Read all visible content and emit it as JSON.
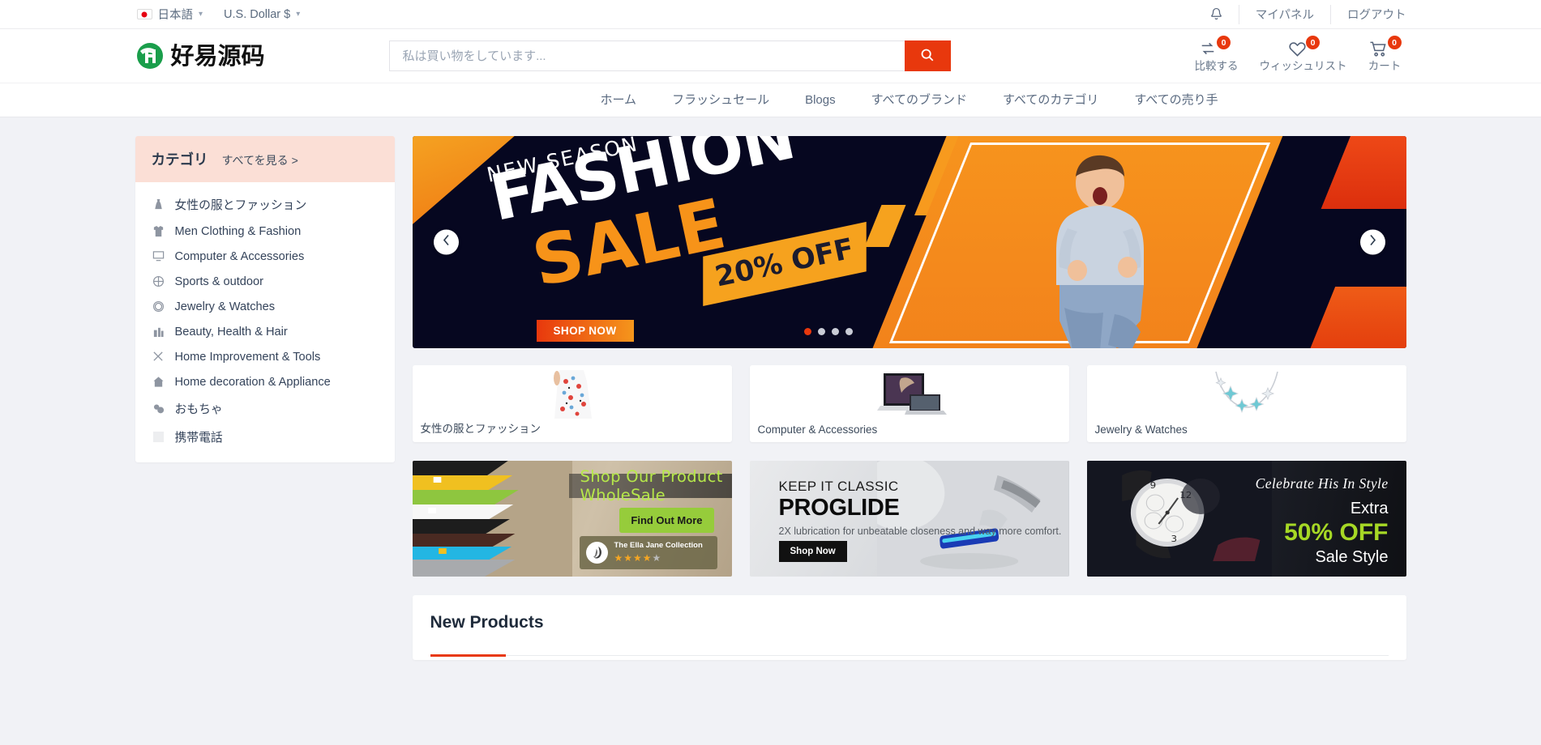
{
  "topbar": {
    "language": "日本語",
    "currency": "U.S. Dollar $",
    "bell_icon": "bell-icon",
    "my_panel": "マイパネル",
    "logout": "ログアウト"
  },
  "header": {
    "logo_text": "好易源码",
    "logo_icon": "brand-logo-icon",
    "search_placeholder": "私は買い物をしています...",
    "search_value": "",
    "search_icon": "search-icon",
    "icons": [
      {
        "name": "compare",
        "icon": "compare-arrows-icon",
        "label": "比較する",
        "count": "0"
      },
      {
        "name": "wishlist",
        "icon": "heart-icon",
        "label": "ウィッシュリスト",
        "count": "0"
      },
      {
        "name": "cart",
        "icon": "shopping-cart-icon",
        "label": "カート",
        "count": "0"
      }
    ]
  },
  "nav": {
    "items": [
      {
        "label": "ホーム"
      },
      {
        "label": "フラッシュセール"
      },
      {
        "label": "Blogs"
      },
      {
        "label": "すべてのブランド"
      },
      {
        "label": "すべてのカテゴリ"
      },
      {
        "label": "すべての売り手"
      }
    ]
  },
  "sidebar": {
    "title": "カテゴリ",
    "view_all": "すべてを見る >",
    "items": [
      {
        "label": "女性の服とファッション",
        "icon": "dress-icon"
      },
      {
        "label": "Men Clothing & Fashion",
        "icon": "shirt-icon"
      },
      {
        "label": "Computer & Accessories",
        "icon": "desktop-computer-icon"
      },
      {
        "label": "Sports & outdoor",
        "icon": "sports-icon"
      },
      {
        "label": "Jewelry & Watches",
        "icon": "watch-icon"
      },
      {
        "label": "Beauty, Health & Hair",
        "icon": "cosmetics-icon"
      },
      {
        "label": "Home Improvement & Tools",
        "icon": "tools-icon"
      },
      {
        "label": "Home decoration & Appliance",
        "icon": "home-decor-icon"
      },
      {
        "label": "おもちゃ",
        "icon": "toys-icon"
      },
      {
        "label": "携帯電話",
        "icon": "mobile-phone-icon"
      }
    ]
  },
  "hero": {
    "eyebrow": "NEW SEASON",
    "title": "FASHION",
    "subtitle": "SALE",
    "discount": "20% OFF",
    "cta": "SHOP NOW",
    "prev_icon": "chevron-left-icon",
    "next_icon": "chevron-right-icon",
    "slides": 4,
    "active_slide": 1
  },
  "category_cards": [
    {
      "label": "女性の服とファッション",
      "image": "floral-dress-photo"
    },
    {
      "label": "Computer & Accessories",
      "image": "laptop-photo"
    },
    {
      "label": "Jewelry & Watches",
      "image": "star-necklace-photo"
    }
  ],
  "promos": {
    "wholesale": {
      "headline": "Shop Our Product WholeSale",
      "cta": "Find Out More",
      "brand": "The Ella Jane Collection",
      "rating": 4,
      "rating_max": 5,
      "image": "stacked-tshirts-photo"
    },
    "proglide": {
      "eyebrow": "KEEP IT CLASSIC",
      "title": "PROGLIDE",
      "subtitle": "2X lubrication for unbeatable closeness and way more comfort.",
      "cta": "Shop Now",
      "image": "razor-photo"
    },
    "watch": {
      "script": "Celebrate His In Style",
      "extra": "Extra",
      "discount": "50% OFF",
      "style": "Sale Style",
      "image": "wristwatch-photo"
    }
  },
  "new_products": {
    "title": "New Products"
  },
  "colors": {
    "accent": "#e8380d",
    "hero_bg": "#060720",
    "sidebar_head": "#fbdfd6",
    "page_bg": "#f1f2f6",
    "promo_green": "#a6d825"
  }
}
